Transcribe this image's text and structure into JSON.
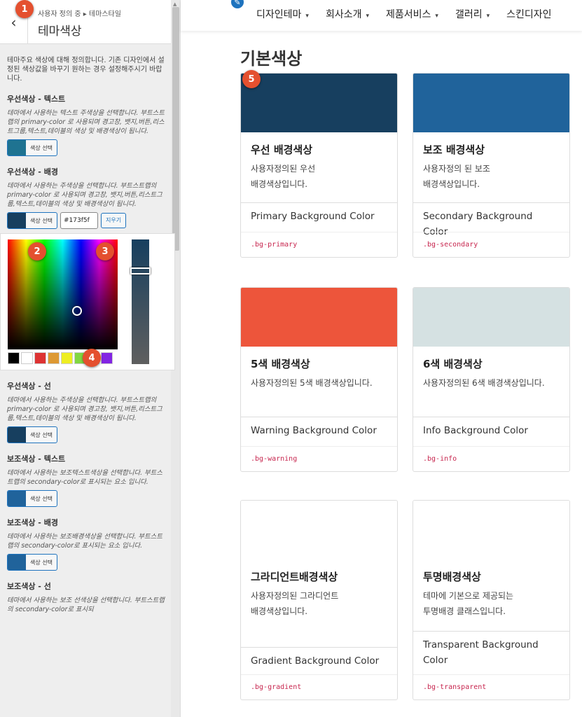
{
  "sidebar": {
    "breadcrumb": "사용자 정의 중 ▸ 테마스타일",
    "section_title": "테마색상",
    "description": "테마주요 색상에 대해 정의합니다. 기존 디자인에서 설정된 색상값을 바꾸기 원하는 경우 설정해주시기 바랍니다.",
    "select_color_label": "색상 선택",
    "clear_label": "지우기",
    "hex_value": "#173f5f",
    "controls": [
      {
        "title": "우선색상 - 텍스트",
        "desc": "테마에서 사용하는 텍스트 주색상을 선택합니다. 부트스트랩의 primary-color 로 사용되며 경고창, 뱃지,버튼,리스트그룹,텍스트,테이블의 색상 및 배경색상이 됩니다.",
        "color": "#1f7391"
      },
      {
        "title": "우선색상 - 배경",
        "desc": "테마에서 사용하는 주색상을 선택합니다. 부트스트랩의 primary-color 로 사용되며 경고창, 뱃지,버튼,리스트그룹,텍스트,테이블의 색상 및 배경색상이 됩니다.",
        "color": "#173f5f"
      },
      {
        "title": "우선색상 - 선",
        "desc": "테마에서 사용하는 주색상을 선택합니다. 부트스트랩의 primary-color 로 사용되며 경고창, 뱃지,버튼,리스트그룹,텍스트,테이블의 색상 및 배경색상이 됩니다.",
        "color": "#173f5f"
      },
      {
        "title": "보조색상 - 텍스트",
        "desc": "테마에서 사용하는 보조텍스트색상을 선택합니다. 부트스트랩의 secondary-color로 표시되는 요소 입니다.",
        "color": "#20639b"
      },
      {
        "title": "보조색상 - 배경",
        "desc": "테마에서 사용하는 보조배경색상을 선택합니다. 부트스트랩의 secondary-color로 표시되는 요소 입니다.",
        "color": "#20639b"
      },
      {
        "title": "보조색상 - 선",
        "desc": "테마에서 사용하는 보조 선색상을 선택합니다. 부트스트랩의 secondary-color로 표시되",
        "color": "#20639b"
      }
    ],
    "palette": [
      "#000000",
      "#ffffff",
      "#dd3333",
      "#dd9933",
      "#eeee22",
      "#81d742",
      "#1e73be",
      "#8224e3"
    ]
  },
  "badges": [
    "1",
    "2",
    "3",
    "4",
    "5"
  ],
  "nav": {
    "edit_icon": "pencil-icon",
    "items": [
      "디자인테마",
      "회사소개",
      "제품서비스",
      "갤러리",
      "스킨디자인"
    ],
    "caret": "▾"
  },
  "main": {
    "title": "기본색상",
    "cards": [
      {
        "title": "우선 배경색상",
        "text": "사용자정의된 우선\n배경색상입니다.",
        "footer": "Primary Background Color",
        "code": ".bg-primary",
        "color": "#173f5f"
      },
      {
        "title": "보조 배경색상",
        "text": "사용자정의 된 보조\n배경색상입니다.",
        "footer": "Secondary Background Color",
        "code": ".bg-secondary",
        "color": "#20639b"
      },
      {
        "title": "5색 배경색상",
        "text": "사용자정의된 5색 배경색상입니다.",
        "footer": "Warning Background Color",
        "code": ".bg-warning",
        "color": "#ed553b"
      },
      {
        "title": "6색 배경색상",
        "text": "사용자정의된 6색 배경색상입니다.",
        "footer": "Info Background Color",
        "code": ".bg-info",
        "color": "#d5e1e2"
      },
      {
        "title": "그라디언트배경색상",
        "text": "사용자정의된 그라디언트\n배경색상입니다.",
        "footer": "Gradient Background Color",
        "code": ".bg-gradient",
        "color": "#ffffff"
      },
      {
        "title": "투명배경색상",
        "text": "테마에 기본으로 제공되는\n투명배경 클래스입니다.",
        "footer": "Transparent Background Color",
        "code": ".bg-transparent",
        "color": "#ffffff"
      }
    ]
  }
}
